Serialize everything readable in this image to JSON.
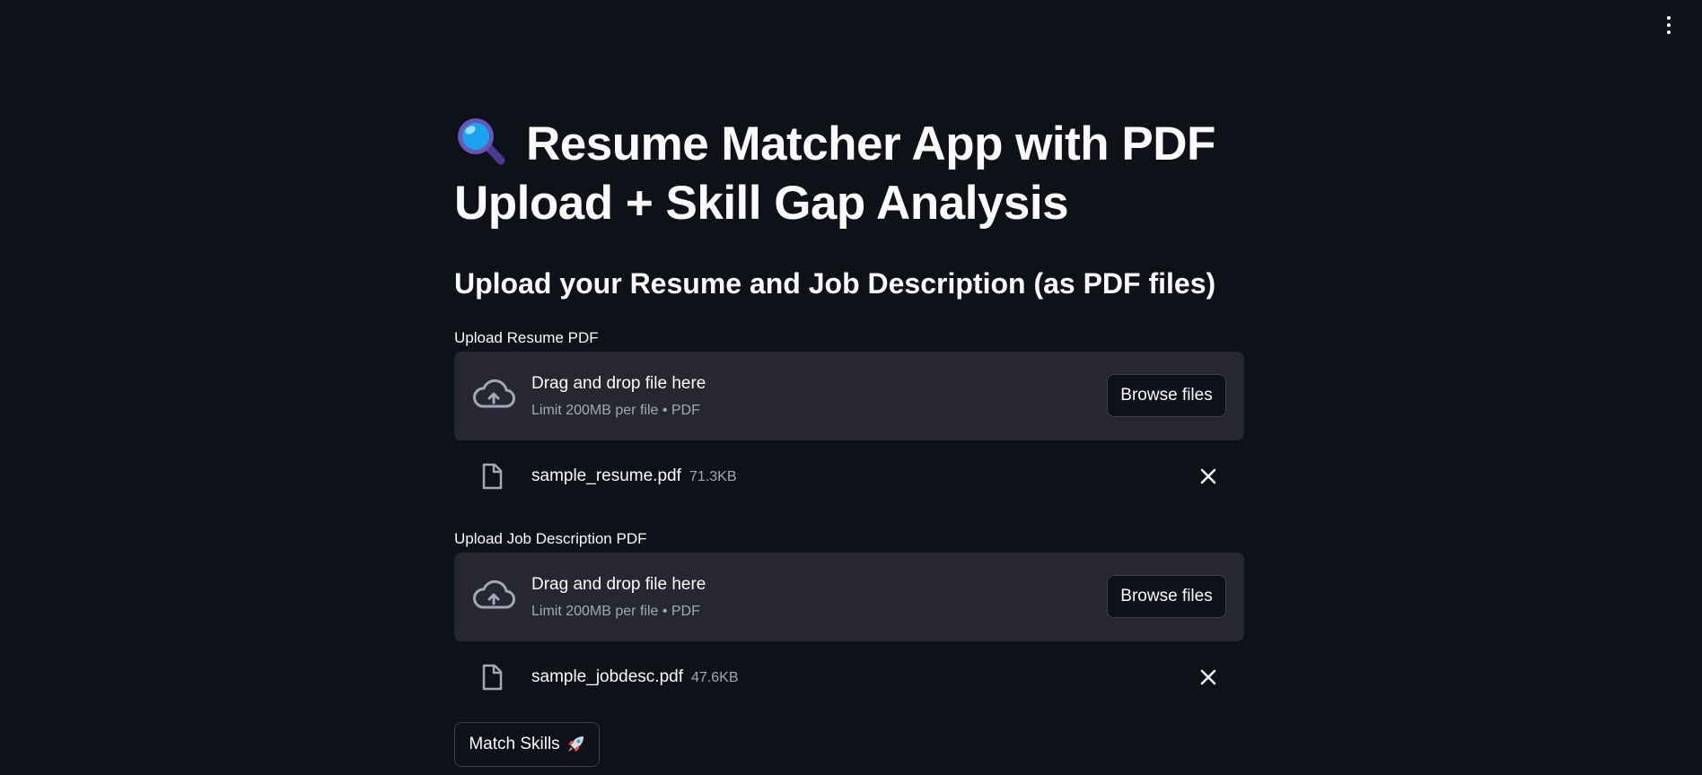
{
  "header": {
    "menu_icon": "kebab-vertical-icon"
  },
  "main": {
    "title_emoji": "magnifying-glass-icon",
    "title": "Resume Matcher App with PDF Upload + Skill Gap Analysis",
    "subheading": "Upload your Resume and Job Description (as PDF files)"
  },
  "uploaders": [
    {
      "label": "Upload Resume PDF",
      "drop_text": "Drag and drop file here",
      "limit_text": "Limit 200MB per file • PDF",
      "browse_label": "Browse files",
      "file": {
        "name": "sample_resume.pdf",
        "size": "71.3KB"
      }
    },
    {
      "label": "Upload Job Description PDF",
      "drop_text": "Drag and drop file here",
      "limit_text": "Limit 200MB per file • PDF",
      "browse_label": "Browse files",
      "file": {
        "name": "sample_jobdesc.pdf",
        "size": "47.6KB"
      }
    }
  ],
  "actions": {
    "match_label": "Match Skills",
    "match_icon": "rocket-icon"
  },
  "colors": {
    "background": "#0e1117",
    "surface": "#262730",
    "text": "#fafafa",
    "muted_text": "#a3a8b8"
  }
}
